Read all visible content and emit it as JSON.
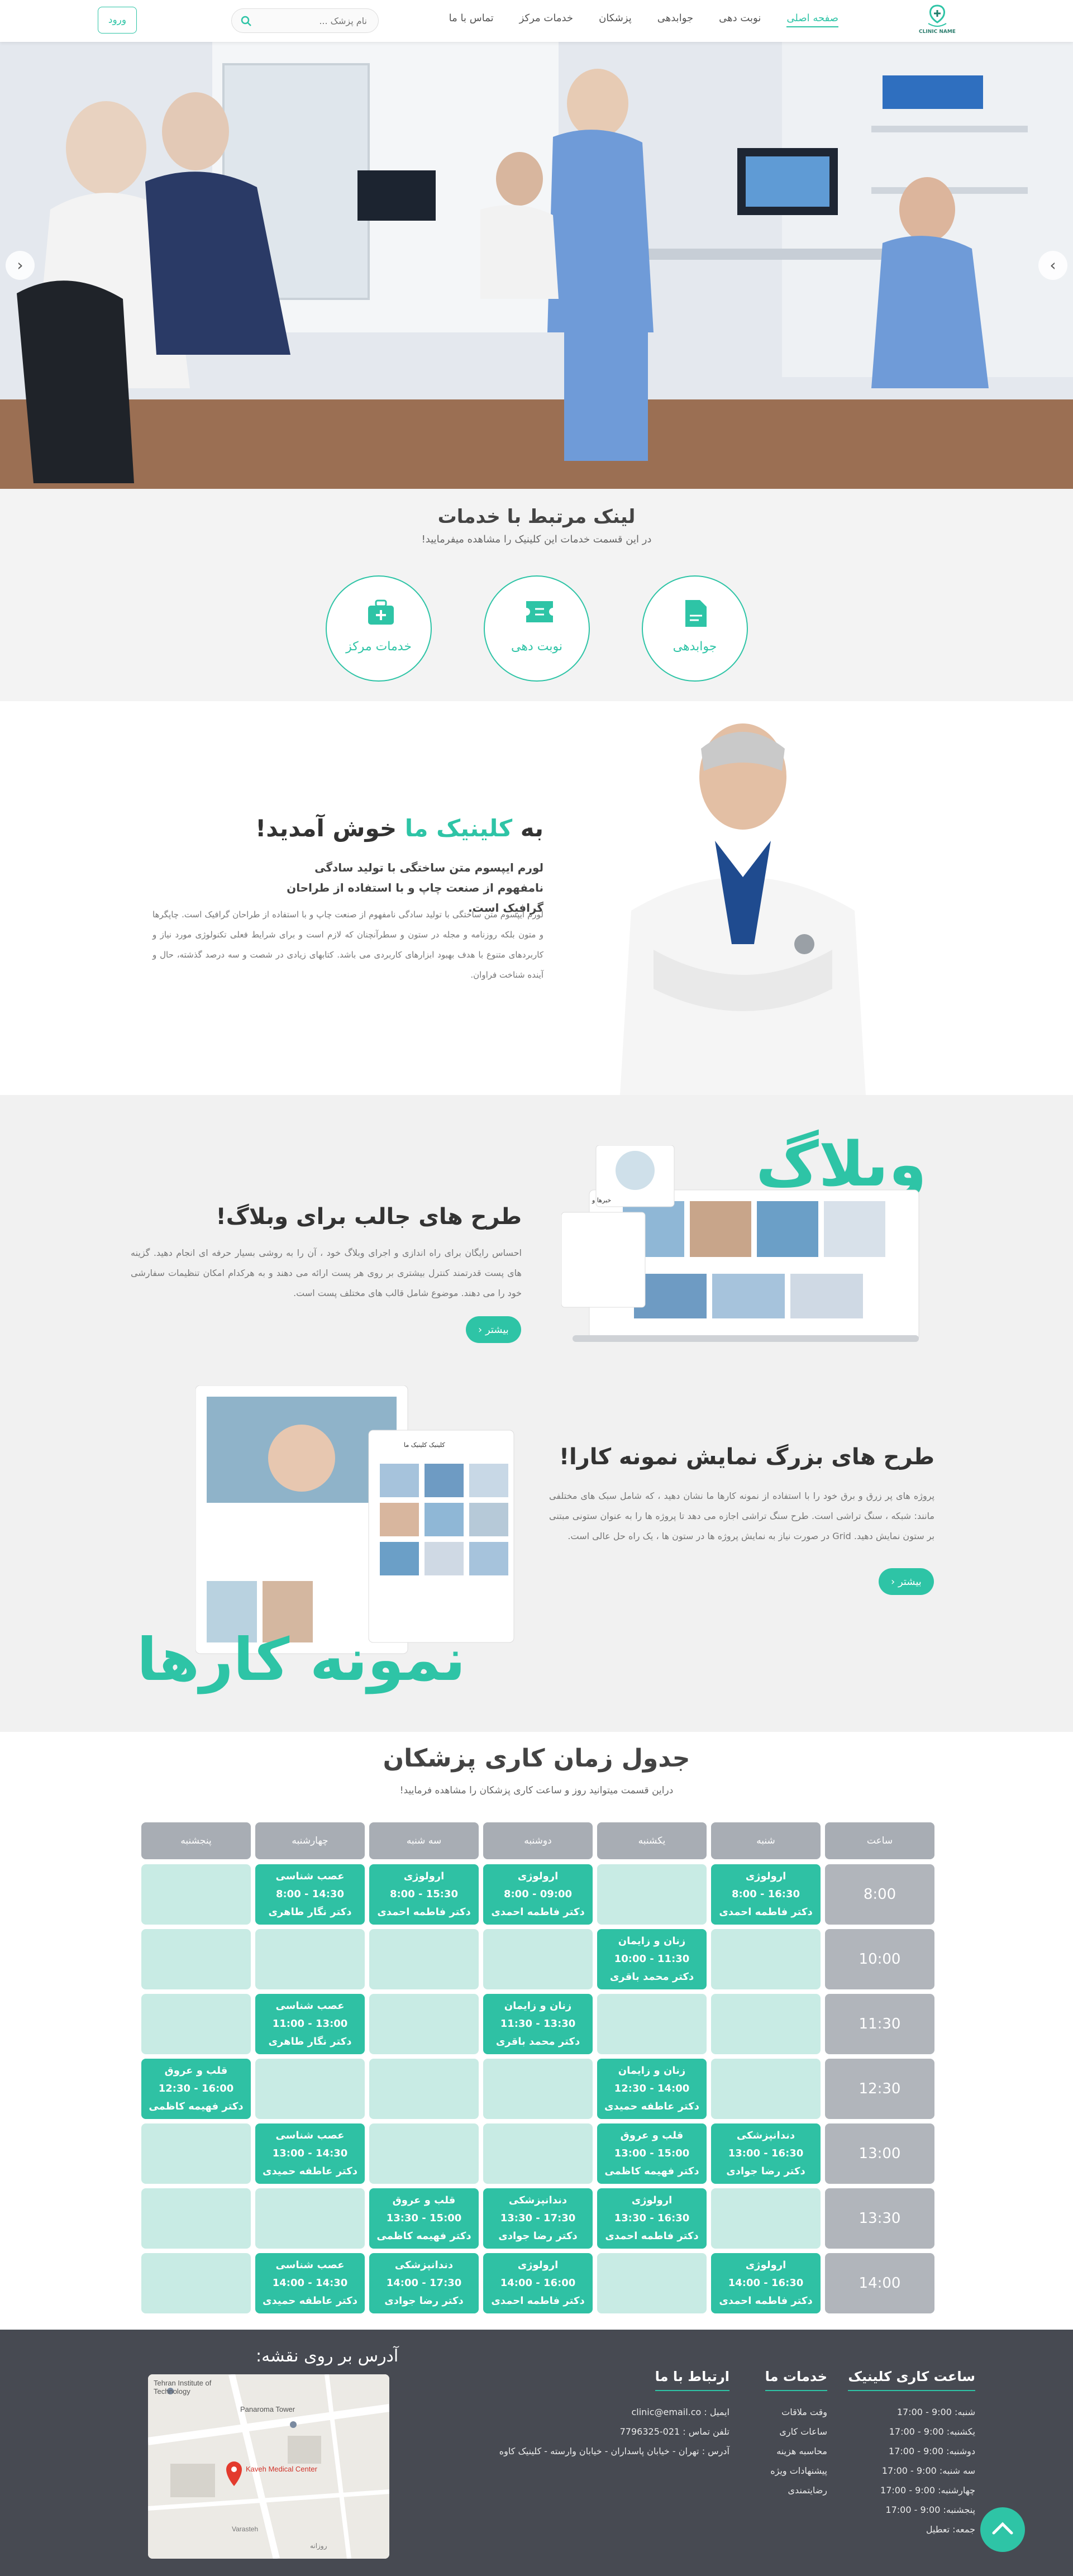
{
  "nav": {
    "logo_text": "CLINIC NAME",
    "links": [
      "صفحه اصلی",
      "نوبت دهی",
      "جوابدهی",
      "پزشکان",
      "خدمات مرکز",
      "تماس با ما"
    ],
    "search_placeholder": "نام پزشک ...",
    "login_label": "ورود"
  },
  "services": {
    "title": "لینک مرتبط با خدمات",
    "subtitle": "در این قسمت خدمات این کلینیک را مشاهده میفرمایید!",
    "items": [
      "جوابدهی",
      "نوبت دهی",
      "خدمات مرکز"
    ]
  },
  "welcome": {
    "title_prefix": "به",
    "title_accent": "کلینیک ما",
    "title_suffix": "خوش آمدید!",
    "lead": "لورم ایپسوم متن ساختگی با تولید سادگی نامفهوم از صنعت چاپ و با استفاده از طراحان گرافیک است.",
    "body": "لورم ایپسوم متن ساختگی با تولید سادگی نامفهوم از صنعت چاپ و با استفاده از طراحان گرافیک است. چاپگرها و متون بلکه روزنامه و مجله در ستون و سطرآنچنان که لازم است و برای شرایط فعلی تکنولوژی مورد نیاز و کاربردهای متنوع با هدف بهبود ابزارهای کاربردی می باشد. کتابهای زیادی در شصت و سه درصد گذشته، حال و آینده شناخت فراوان."
  },
  "blog": {
    "big_word": "وبلاگ",
    "title": "طرح های جالب برای وبلاگ!",
    "desc": "احساس رایگان برای راه اندازی و اجرای وبلاگ خود ، آن را به روشی بسیار حرفه ای انجام دهید. گزینه های پست قدرتمند کنترل بیشتری بر روی هر پست ارائه می دهند و به هرکدام امکان تنظیمات سفارشی خود را می دهند. موضوع شامل قالب های مختلف پست است.",
    "more_label": "بیشتر",
    "mock_header": "خبرها و"
  },
  "portfolio": {
    "big_word": "نمونه کارها",
    "title": "طرح های بزرگ نمایش نمونه کارا!",
    "desc": "پروژه های پر زرق و برق خود را با استفاده از نمونه کارها ما نشان دهید ، که شامل سبک های مختلفی مانند: شبکه ، سنگ تراشی است. طرح سنگ تراشی اجازه می دهد تا پروژه ها را به عنوان ستونی مبتنی بر ستون نمایش دهید. Grid در صورت نیاز به نمایش پروژه ها در ستون ها ، یک راه حل عالی است.",
    "more_label": "بیشتر",
    "mock_header": "کلینیک کلینیک ما"
  },
  "schedule": {
    "title": "جدول زمان کاری پزشکان",
    "subtitle": "دراین قسمت میتوانید روز و ساعت کاری پزشکان را مشاهده فرمایید!",
    "headers": [
      "ساعت",
      "شنبه",
      "یکشنبه",
      "دوشنبه",
      "سه شنبه",
      "چهارشنبه",
      "پنجشنبه"
    ],
    "rows": [
      {
        "time": "8:00",
        "cells": [
          {
            "spec": "ارولوژی",
            "time": "16:30 - 8:00",
            "doctor": "دکتر فاطمه احمدی"
          },
          null,
          {
            "spec": "ارولوژی",
            "time": "09:00 - 8:00",
            "doctor": "دکتر فاطمه احمدی"
          },
          {
            "spec": "ارولوژی",
            "time": "15:30 - 8:00",
            "doctor": "دکتر فاطمه احمدی"
          },
          {
            "spec": "عصب شناسی",
            "time": "14:30 - 8:00",
            "doctor": "دکتر نگار طاهری"
          },
          null
        ]
      },
      {
        "time": "10:00",
        "cells": [
          null,
          {
            "spec": "زنان و زایمان",
            "time": "11:30 - 10:00",
            "doctor": "دکتر محمد باقری"
          },
          null,
          null,
          null,
          null
        ]
      },
      {
        "time": "11:30",
        "cells": [
          null,
          null,
          {
            "spec": "زنان و زایمان",
            "time": "13:30 - 11:30",
            "doctor": "دکتر محمد باقری"
          },
          null,
          {
            "spec": "عصب شناسی",
            "time": "13:00 - 11:00",
            "doctor": "دکتر نگار طاهری"
          },
          null
        ]
      },
      {
        "time": "12:30",
        "cells": [
          null,
          {
            "spec": "زنان و زایمان",
            "time": "14:00 - 12:30",
            "doctor": "دکتر عاطفه حمیدی"
          },
          null,
          null,
          null,
          {
            "spec": "قلب و عروق",
            "time": "16:00 - 12:30",
            "doctor": "دکتر فهیمه کاظمی"
          }
        ]
      },
      {
        "time": "13:00",
        "cells": [
          {
            "spec": "دندانپزشکی",
            "time": "16:30 - 13:00",
            "doctor": "دکتر رضا جوادی"
          },
          {
            "spec": "قلب و عروق",
            "time": "15:00 - 13:00",
            "doctor": "دکتر فهیمه کاظمی"
          },
          null,
          null,
          {
            "spec": "عصب شناسی",
            "time": "14:30 - 13:00",
            "doctor": "دکتر عاطفه حمیدی"
          },
          null
        ]
      },
      {
        "time": "13:30",
        "cells": [
          null,
          {
            "spec": "ارولوژی",
            "time": "16:30 - 13:30",
            "doctor": "دکتر فاطمه احمدی"
          },
          {
            "spec": "دندانپزشکی",
            "time": "17:30 - 13:30",
            "doctor": "دکتر رضا جوادی"
          },
          {
            "spec": "قلب و عروق",
            "time": "15:00 - 13:30",
            "doctor": "دکتر فهیمه کاظمی"
          },
          null,
          null
        ]
      },
      {
        "time": "14:00",
        "cells": [
          {
            "spec": "ارولوژی",
            "time": "16:30 - 14:00",
            "doctor": "دکتر فاطمه احمدی"
          },
          null,
          {
            "spec": "ارولوژی",
            "time": "16:00 - 14:00",
            "doctor": "دکتر فاطمه احمدی"
          },
          {
            "spec": "دندانپزشکی",
            "time": "17:30 - 14:00",
            "doctor": "دکتر رضا جوادی"
          },
          {
            "spec": "عصب شناسی",
            "time": "14:30 - 14:00",
            "doctor": "دکتر عاطفه حمیدی"
          },
          null
        ]
      }
    ]
  },
  "footer": {
    "hours": {
      "title": "ساعت کاری کلینیک",
      "items": [
        "شنبه: 9:00 - 17:00",
        "یکشنبه: 9:00 - 17:00",
        "دوشنبه: 9:00 - 17:00",
        "سه شنبه: 9:00 - 17:00",
        "چهارشنبه: 9:00 - 17:00",
        "پنجشنبه: 9:00 - 17:00",
        "جمعه: تعطیل"
      ]
    },
    "services": {
      "title": "خدمات ما",
      "items": [
        "وقت ملاقات",
        "ساعات کاری",
        "محاسبه هزینه",
        "پیشنهادات ویژه",
        "رضایتمندی"
      ]
    },
    "contact": {
      "title": "ارتباط با ما",
      "items": [
        "ایمیل : clinic@email.co",
        "تلفن تماس : 021-7796325",
        "آدرس : تهران - خیابان پاسداران - خیابان وارسته - کلینیک کاوه"
      ]
    },
    "map": {
      "title": "آدرس بر روی نقشه:",
      "marker_label": "Kaveh Medical Center",
      "labels": [
        "Tehran Institute of Technology",
        "Panaroma Tower",
        "Varasteh",
        "روزانه"
      ]
    }
  },
  "colors": {
    "accent": "#2ec4a6",
    "footer_bg": "#474a52",
    "cell_empty": "#c8ebe4",
    "time_cell": "#b1b5bb"
  }
}
